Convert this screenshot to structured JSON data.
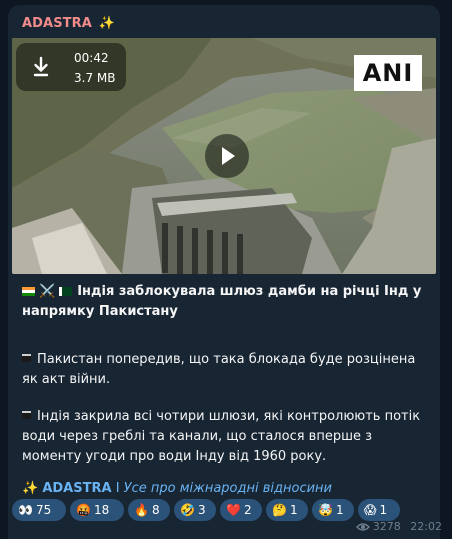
{
  "post": {
    "channel_name": "ADASTRA",
    "channel_emoji": "✨",
    "media": {
      "duration": "00:42",
      "size": "3.7 MB",
      "watermark": "ANI"
    },
    "title": "Індія заблокувала шлюз дамби на річці Інд у напрямку Пакистану",
    "title_swords": "⚔️",
    "paragraph1": "Пакистан попередив, що така блокада буде розцінена як акт війни.",
    "paragraph2": "Індія закрила всі чотири шлюзи, які контролюють потік води через греблі та канали, що сталося вперше з моменту угоди про води Інду від 1960 року.",
    "source": {
      "emoji": "✨",
      "name": "ADASTRA",
      "separator": "I",
      "topic": "Усе про міжнародні відносини"
    },
    "reactions": [
      {
        "emoji": "👀",
        "count": "75"
      },
      {
        "emoji": "🤬",
        "count": "18"
      },
      {
        "emoji": "🔥",
        "count": "8"
      },
      {
        "emoji": "🤣",
        "count": "3"
      },
      {
        "emoji": "❤️",
        "count": "2"
      },
      {
        "emoji": "🤔",
        "count": "1"
      },
      {
        "emoji": "🤯",
        "count": "1"
      },
      {
        "emoji": "😱",
        "count": "1"
      }
    ],
    "views": "3278",
    "time": "22:02"
  },
  "colors": {
    "bg": "#0e1621",
    "bubble": "#182533",
    "channel_name": "#f28b8b",
    "link": "#6ab3f3",
    "reaction_bg": "#2b5278"
  }
}
